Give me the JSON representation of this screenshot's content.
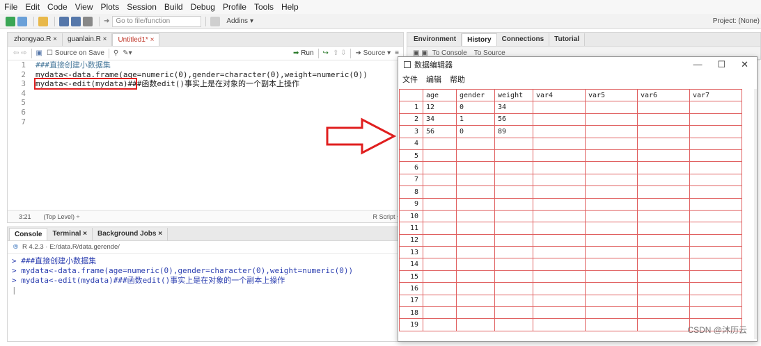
{
  "menubar": [
    "File",
    "Edit",
    "Code",
    "View",
    "Plots",
    "Session",
    "Build",
    "Debug",
    "Profile",
    "Tools",
    "Help"
  ],
  "toolbar": {
    "goto_placeholder": "Go to file/function",
    "addins": "Addins",
    "project": "Project: (None)"
  },
  "source": {
    "tabs": [
      "zhongyao.R",
      "guanlain.R",
      "Untitled1*"
    ],
    "active_tab": 2,
    "source_on_save": "Source on Save",
    "run": "Run",
    "source": "Source",
    "lines": [
      "###直接创建小数据集",
      "mydata<-data.frame(age=numeric(0),gender=character(0),weight=numeric(0))",
      "mydata<-edit(mydata)###函数edit()事实上是在对象的一个副本上操作",
      "",
      "",
      "",
      ""
    ],
    "line_numbers": [
      "1",
      "2",
      "3",
      "4",
      "5",
      "6",
      "7"
    ],
    "status_pos": "3:21",
    "status_level": "(Top Level) ÷",
    "status_type": "R Script ÷"
  },
  "console": {
    "tabs": [
      "Console",
      "Terminal",
      "Background Jobs"
    ],
    "path": "R 4.2.3 · E:/data.R/data.gerende/",
    "lines": [
      "> ###直接创建小数据集",
      "> mydata<-data.frame(age=numeric(0),gender=character(0),weight=numeric(0))",
      "> mydata<-edit(mydata)###函数edit()事实上是在对象的一个副本上操作"
    ]
  },
  "env": {
    "tabs": [
      "Environment",
      "History",
      "Connections",
      "Tutorial"
    ],
    "to_console": "To Console",
    "to_source": "To Source"
  },
  "editor_dialog": {
    "title": "数据编辑器",
    "menu": [
      "文件",
      "编辑",
      "帮助"
    ],
    "columns": [
      "age",
      "gender",
      "weight",
      "var4",
      "var5",
      "var6",
      "var7"
    ],
    "rows": [
      [
        "12",
        "0",
        "34",
        "",
        "",
        "",
        ""
      ],
      [
        "34",
        "1",
        "56",
        "",
        "",
        "",
        ""
      ],
      [
        "56",
        "0",
        "89",
        "",
        "",
        "",
        ""
      ]
    ],
    "row_count": 19
  },
  "watermark": "CSDN @沐历云"
}
